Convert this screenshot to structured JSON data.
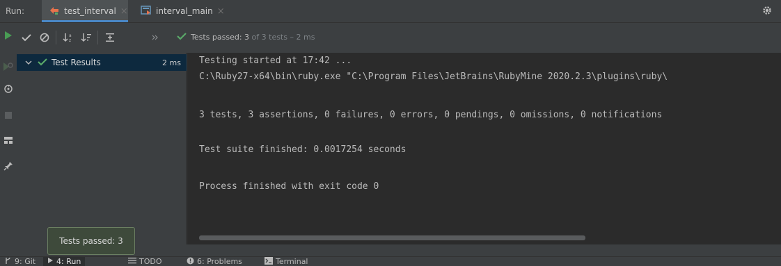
{
  "header": {
    "run_label": "Run:",
    "tabs": [
      {
        "label": "test_interval",
        "icon": "ruby-test-icon",
        "active": true
      },
      {
        "label": "interval_main",
        "icon": "run-config-icon",
        "active": false
      }
    ]
  },
  "toolbar": {
    "status_prefix": "Tests passed:",
    "status_passed": "3",
    "status_of": "of 3 tests",
    "status_time": "– 2 ms"
  },
  "tree": {
    "root_label": "Test Results",
    "root_duration": "2 ms"
  },
  "console": {
    "lines": [
      "Testing started at 17:42 ...",
      "C:\\Ruby27-x64\\bin\\ruby.exe \"C:\\Program Files\\JetBrains\\RubyMine 2020.2.3\\plugins\\ruby\\",
      "",
      "3 tests, 3 assertions, 0 failures, 0 errors, 0 pendings, 0 omissions, 0 notifications",
      "",
      "Test suite finished: 0.0017254 seconds",
      "",
      "Process finished with exit code 0"
    ]
  },
  "tooltip": {
    "text": "Tests passed: 3"
  },
  "bottom_bar": {
    "items": [
      {
        "label": "9: Git",
        "icon": "git-icon"
      },
      {
        "label": "4: Run",
        "icon": "run-icon",
        "active": true
      },
      {
        "label": "TODO",
        "icon": "todo-icon"
      },
      {
        "label": "6: Problems",
        "icon": "problems-icon"
      },
      {
        "label": "Terminal",
        "icon": "terminal-icon"
      }
    ]
  },
  "colors": {
    "pass_green": "#59a869",
    "run_green": "#499c54",
    "accent_blue": "#4a88c7",
    "console_bg": "#2b2b2b",
    "panel_bg": "#3c3f41"
  }
}
